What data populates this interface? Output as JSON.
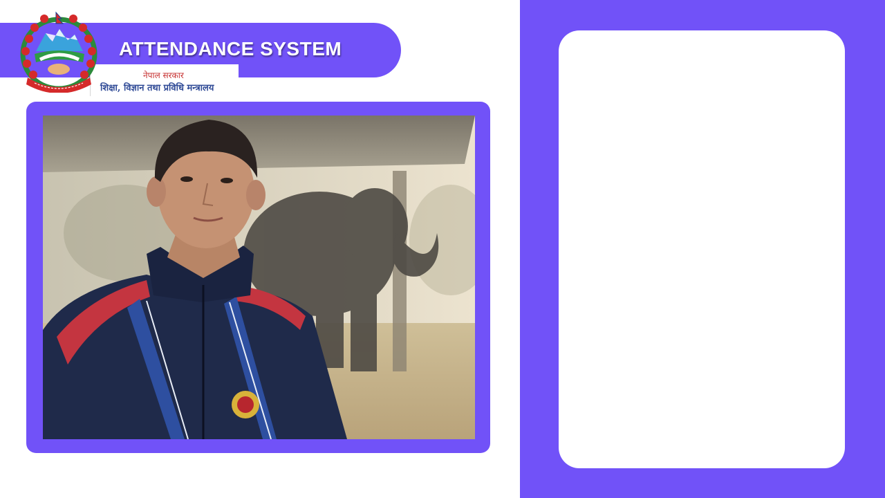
{
  "header": {
    "title": "ATTENDANCE SYSTEM",
    "emblem_icon": "nepal-government-emblem-icon",
    "ministry": {
      "line1": "नेपाल सरकार",
      "line2": "शिक्षा, विज्ञान तथा प्रविधि मन्त्रालय"
    }
  },
  "camera": {
    "feed_icon": "live-camera-feed"
  },
  "colors": {
    "accent": "#7152f8",
    "panel": "#ffffff",
    "title_text": "#ffffff",
    "ministry_red": "#c62f2f",
    "ministry_blue": "#2f4a96"
  }
}
